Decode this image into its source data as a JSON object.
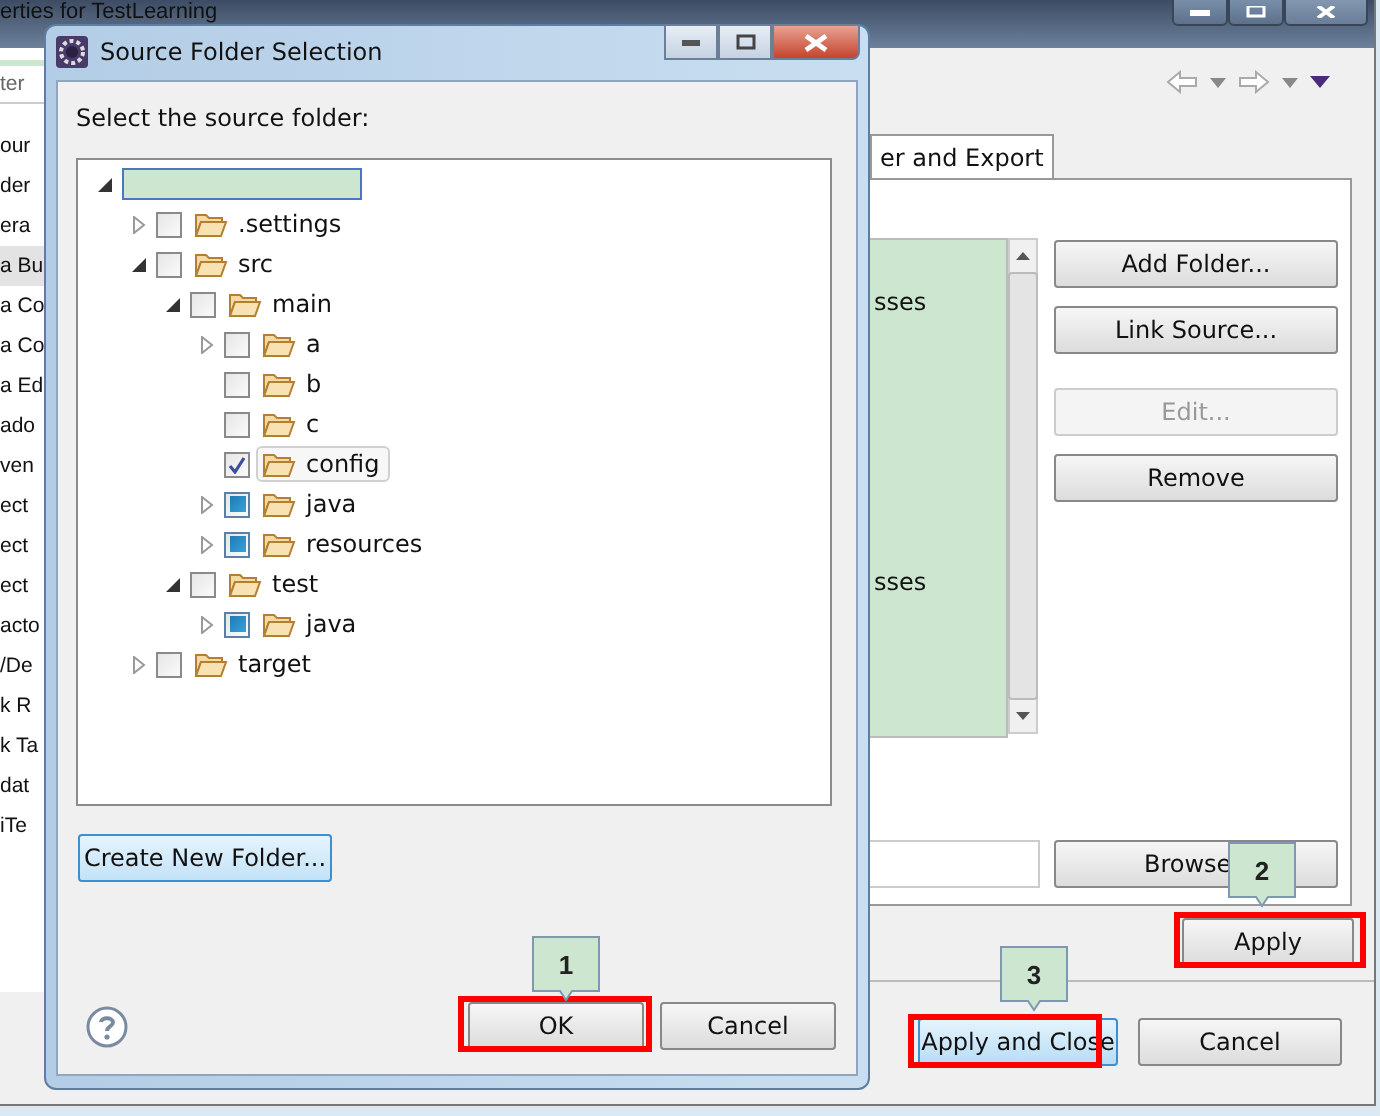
{
  "background_window": {
    "title": "erties for TestLearning",
    "filter": {
      "value": "ter"
    },
    "sidebar": {
      "items": [
        {
          "label": "our",
          "selected": false
        },
        {
          "label": "der",
          "selected": false
        },
        {
          "label": "era",
          "selected": false
        },
        {
          "label": "a Bu",
          "selected": true
        },
        {
          "label": "a Co",
          "selected": false
        },
        {
          "label": "a Co",
          "selected": false
        },
        {
          "label": "a Ed",
          "selected": false
        },
        {
          "label": "ado",
          "selected": false
        },
        {
          "label": "ven",
          "selected": false
        },
        {
          "label": "ect",
          "selected": false
        },
        {
          "label": "ect",
          "selected": false
        },
        {
          "label": "ect",
          "selected": false
        },
        {
          "label": "acto",
          "selected": false
        },
        {
          "label": "/De",
          "selected": false
        },
        {
          "label": "k R",
          "selected": false
        },
        {
          "label": "k Ta",
          "selected": false
        },
        {
          "label": "dat",
          "selected": false
        },
        {
          "label": "iTe",
          "selected": false
        }
      ]
    },
    "tab": {
      "label": "er and Export",
      "selected": true
    },
    "source_list": {
      "items": [
        "sses",
        "sses"
      ]
    },
    "side_buttons": [
      {
        "label": "Add Folder...",
        "disabled": false
      },
      {
        "label": "Link Source...",
        "disabled": false
      },
      {
        "label": "Edit...",
        "disabled": true
      },
      {
        "label": "Remove",
        "disabled": false
      }
    ],
    "browse_button": "Browse",
    "apply_button": "Apply",
    "footer_buttons": [
      "Apply and Close",
      "Cancel"
    ]
  },
  "dialog": {
    "title": "Source Folder Selection",
    "prompt": "Select the source folder:",
    "tree": {
      "expandable": true,
      "expanded": true,
      "children": [
        {
          "label": ".settings",
          "expandable": true,
          "expanded": false,
          "checked": false,
          "grayed": false,
          "selected": false
        },
        {
          "label": "src",
          "expandable": true,
          "expanded": true,
          "checked": false,
          "grayed": false,
          "selected": false,
          "children": [
            {
              "label": "main",
              "expandable": true,
              "expanded": true,
              "checked": false,
              "grayed": false,
              "selected": false,
              "children": [
                {
                  "label": "a",
                  "expandable": true,
                  "expanded": false,
                  "checked": false,
                  "grayed": false,
                  "selected": false
                },
                {
                  "label": "b",
                  "expandable": false,
                  "checked": false,
                  "grayed": false,
                  "selected": false
                },
                {
                  "label": "c",
                  "expandable": false,
                  "checked": false,
                  "grayed": false,
                  "selected": false
                },
                {
                  "label": "config",
                  "expandable": false,
                  "checked": true,
                  "grayed": false,
                  "selected": true
                },
                {
                  "label": "java",
                  "expandable": true,
                  "expanded": false,
                  "checked": false,
                  "grayed": true,
                  "selected": false
                },
                {
                  "label": "resources",
                  "expandable": true,
                  "expanded": false,
                  "checked": false,
                  "grayed": true,
                  "selected": false
                }
              ]
            },
            {
              "label": "test",
              "expandable": true,
              "expanded": true,
              "checked": false,
              "grayed": false,
              "selected": false,
              "children": [
                {
                  "label": "java",
                  "expandable": true,
                  "expanded": false,
                  "checked": false,
                  "grayed": true,
                  "selected": false
                }
              ]
            }
          ]
        },
        {
          "label": "target",
          "expandable": true,
          "expanded": false,
          "checked": false,
          "grayed": false,
          "selected": false
        }
      ]
    },
    "create_button": "Create New Folder...",
    "buttons": [
      "OK",
      "Cancel"
    ]
  },
  "callouts": [
    {
      "label": "1"
    },
    {
      "label": "2"
    },
    {
      "label": "3"
    }
  ]
}
